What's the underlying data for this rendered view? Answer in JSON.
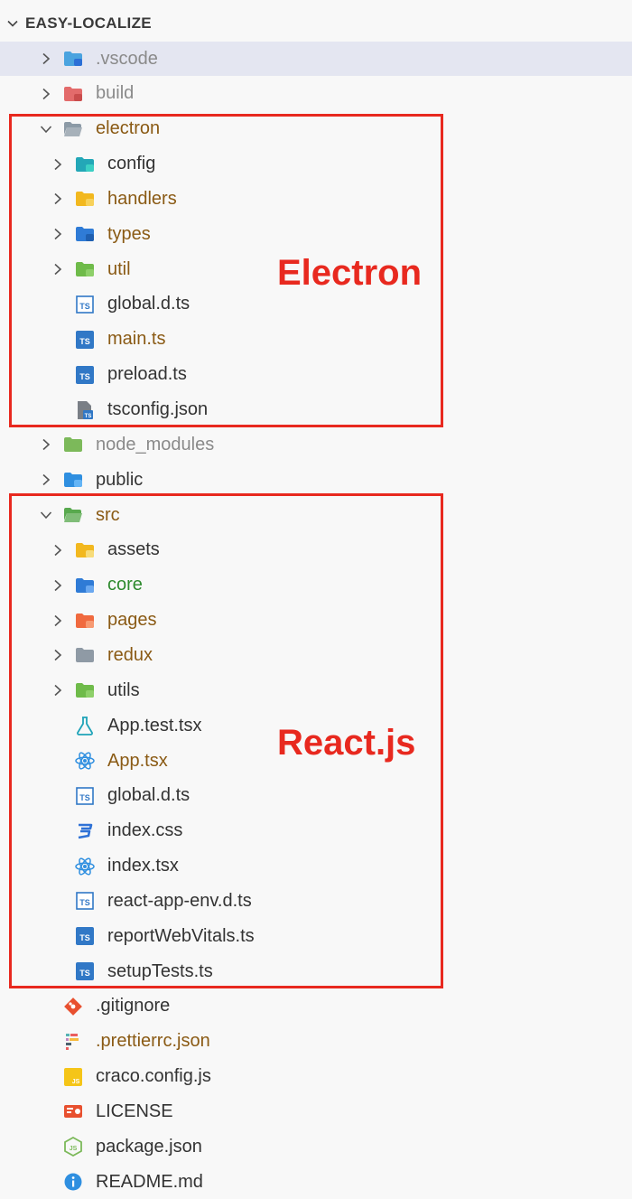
{
  "explorer": {
    "title": "EASY-LOCALIZE",
    "items": [
      {
        "label": ".vscode",
        "depth": 0,
        "type": "folder",
        "icon": "vscode-folder-icon",
        "color": "dim",
        "selected": true
      },
      {
        "label": "build",
        "depth": 0,
        "type": "folder",
        "icon": "build-folder-icon",
        "color": "dim"
      },
      {
        "label": "electron",
        "depth": 0,
        "type": "folder-open",
        "icon": "folder-open-icon",
        "color": "brown"
      },
      {
        "label": "config",
        "depth": 1,
        "type": "folder",
        "icon": "config-folder-icon",
        "color": "dark"
      },
      {
        "label": "handlers",
        "depth": 1,
        "type": "folder",
        "icon": "handlers-folder-icon",
        "color": "brown"
      },
      {
        "label": "types",
        "depth": 1,
        "type": "folder",
        "icon": "types-folder-icon",
        "color": "brown"
      },
      {
        "label": "util",
        "depth": 1,
        "type": "folder",
        "icon": "util-folder-icon",
        "color": "brown"
      },
      {
        "label": "global.d.ts",
        "depth": 1,
        "type": "file",
        "icon": "typescript-def-icon",
        "color": "dark"
      },
      {
        "label": "main.ts",
        "depth": 1,
        "type": "file",
        "icon": "typescript-icon",
        "color": "brown"
      },
      {
        "label": "preload.ts",
        "depth": 1,
        "type": "file",
        "icon": "typescript-icon",
        "color": "dark"
      },
      {
        "label": "tsconfig.json",
        "depth": 1,
        "type": "file",
        "icon": "tsconfig-icon",
        "color": "dark"
      },
      {
        "label": "node_modules",
        "depth": 0,
        "type": "folder",
        "icon": "node-modules-folder-icon",
        "color": "dim"
      },
      {
        "label": "public",
        "depth": 0,
        "type": "folder",
        "icon": "public-folder-icon",
        "color": "dark"
      },
      {
        "label": "src",
        "depth": 0,
        "type": "folder-open",
        "icon": "src-folder-open-icon",
        "color": "brown"
      },
      {
        "label": "assets",
        "depth": 1,
        "type": "folder",
        "icon": "assets-folder-icon",
        "color": "dark"
      },
      {
        "label": "core",
        "depth": 1,
        "type": "folder",
        "icon": "core-folder-icon",
        "color": "green"
      },
      {
        "label": "pages",
        "depth": 1,
        "type": "folder",
        "icon": "pages-folder-icon",
        "color": "brown"
      },
      {
        "label": "redux",
        "depth": 1,
        "type": "folder",
        "icon": "redux-folder-icon",
        "color": "brown"
      },
      {
        "label": "utils",
        "depth": 1,
        "type": "folder",
        "icon": "utils-folder-icon",
        "color": "dark"
      },
      {
        "label": "App.test.tsx",
        "depth": 1,
        "type": "file",
        "icon": "test-flask-icon",
        "color": "dark"
      },
      {
        "label": "App.tsx",
        "depth": 1,
        "type": "file",
        "icon": "react-icon",
        "color": "brown"
      },
      {
        "label": "global.d.ts",
        "depth": 1,
        "type": "file",
        "icon": "typescript-def-icon",
        "color": "dark"
      },
      {
        "label": "index.css",
        "depth": 1,
        "type": "file",
        "icon": "css-icon",
        "color": "dark"
      },
      {
        "label": "index.tsx",
        "depth": 1,
        "type": "file",
        "icon": "react-icon",
        "color": "dark"
      },
      {
        "label": "react-app-env.d.ts",
        "depth": 1,
        "type": "file",
        "icon": "typescript-def-icon",
        "color": "dark"
      },
      {
        "label": "reportWebVitals.ts",
        "depth": 1,
        "type": "file",
        "icon": "typescript-icon",
        "color": "dark"
      },
      {
        "label": "setupTests.ts",
        "depth": 1,
        "type": "file",
        "icon": "typescript-icon",
        "color": "dark"
      },
      {
        "label": ".gitignore",
        "depth": 0,
        "type": "file",
        "icon": "git-icon",
        "color": "dark"
      },
      {
        "label": ".prettierrc.json",
        "depth": 0,
        "type": "file",
        "icon": "prettier-icon",
        "color": "brown"
      },
      {
        "label": "craco.config.js",
        "depth": 0,
        "type": "file",
        "icon": "javascript-icon",
        "color": "dark"
      },
      {
        "label": "LICENSE",
        "depth": 0,
        "type": "file",
        "icon": "license-icon",
        "color": "dark"
      },
      {
        "label": "package.json",
        "depth": 0,
        "type": "file",
        "icon": "nodejs-icon",
        "color": "dark"
      },
      {
        "label": "README.md",
        "depth": 0,
        "type": "file",
        "icon": "info-icon",
        "color": "dark"
      }
    ]
  },
  "annotations": {
    "electron_label": "Electron",
    "react_label": "React.js"
  },
  "colors": {
    "annotation_red": "#e8291f",
    "selection": "#e4e6f1"
  }
}
